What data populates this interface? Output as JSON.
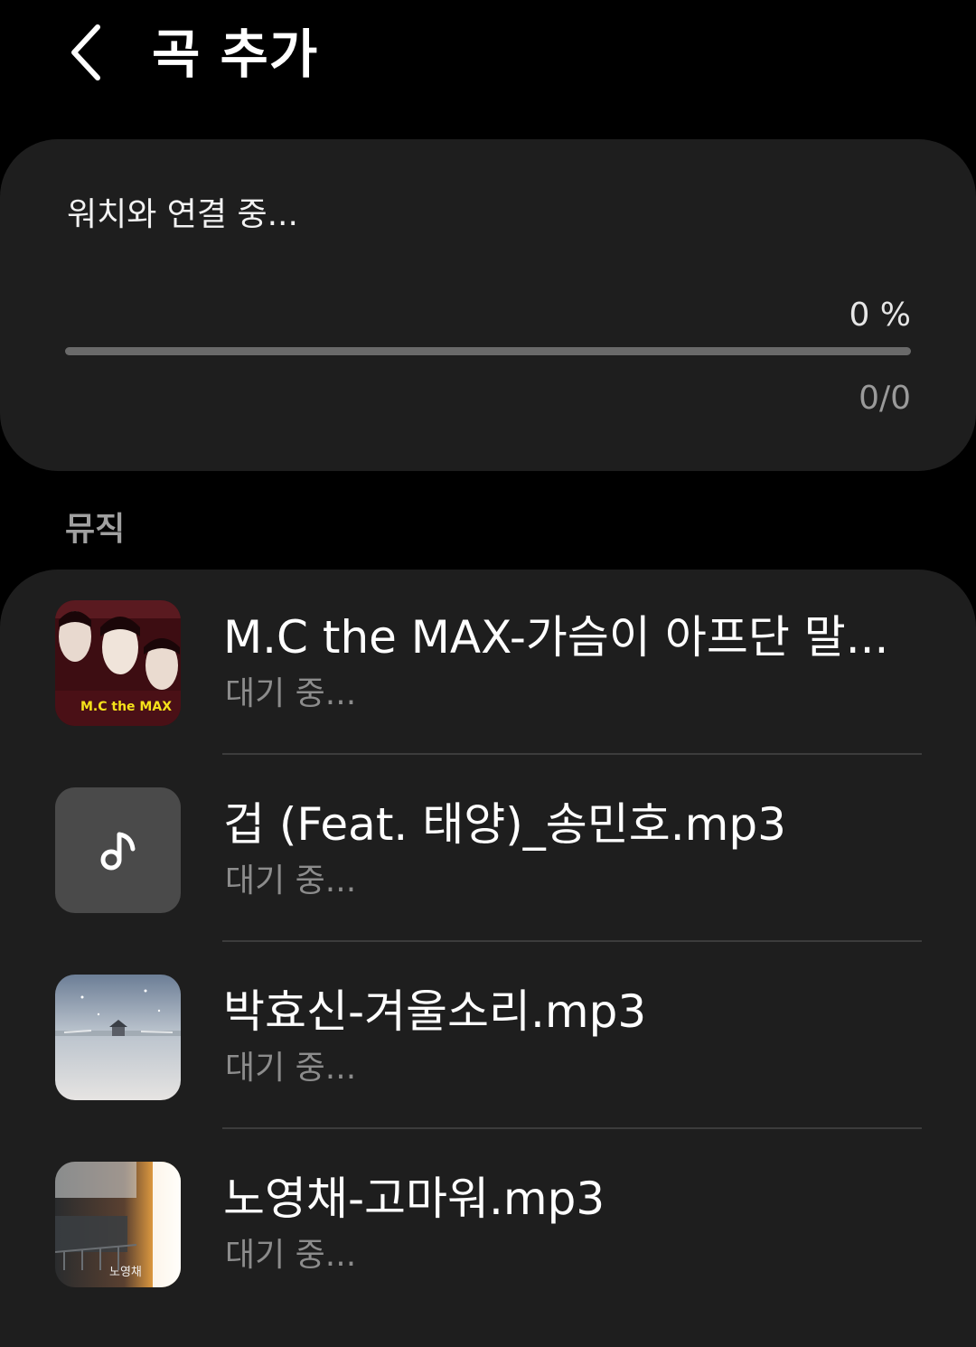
{
  "header": {
    "back_icon": "chevron-left-icon",
    "title": "곡 추가"
  },
  "progress": {
    "status": "워치와 연결 중...",
    "percent_label": "0 %",
    "percent_value": 0,
    "count_label": "0/0",
    "accent_color": "#8fb2ff"
  },
  "section": {
    "label": "뮤직"
  },
  "songs": [
    {
      "title": "M.C the MAX-가슴이 아프단 말...",
      "status": "대기 중...",
      "thumb": "album-art-mc-the-max",
      "art_caption": "M.C the MAX"
    },
    {
      "title": "겁 (Feat. 태양)_송민호.mp3",
      "status": "대기 중...",
      "thumb": "music-note-icon"
    },
    {
      "title": "박효신-겨울소리.mp3",
      "status": "대기 중...",
      "thumb": "album-art-winter"
    },
    {
      "title": "노영채-고마워.mp3",
      "status": "대기 중...",
      "thumb": "album-art-sunset",
      "art_caption": "노영채"
    }
  ]
}
